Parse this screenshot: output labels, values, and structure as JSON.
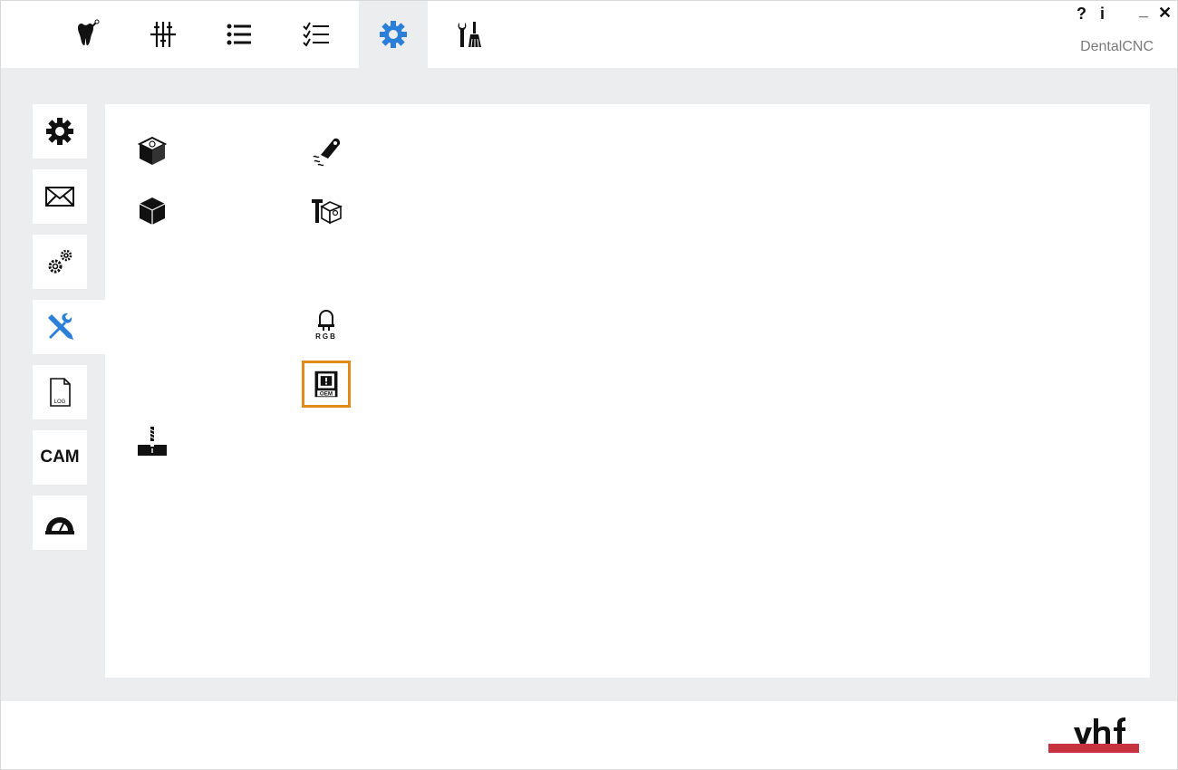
{
  "app": {
    "name": "DentalCNC",
    "help_label": "?",
    "info_label": "i",
    "minimize_label": "_",
    "close_label": "✕"
  },
  "top_tabs": [
    {
      "icon": "tooth-tool-icon"
    },
    {
      "icon": "sliders-icon"
    },
    {
      "icon": "list-icon"
    },
    {
      "icon": "checklist-icon"
    },
    {
      "icon": "gear-icon",
      "active": true
    },
    {
      "icon": "tools-cleaning-icon"
    }
  ],
  "sidebar": {
    "items": [
      {
        "icon": "gear-icon"
      },
      {
        "icon": "envelope-icon"
      },
      {
        "icon": "gears-icon"
      },
      {
        "icon": "wrench-screwdriver-icon",
        "active": true
      },
      {
        "icon": "log-file-icon",
        "label": "LOG"
      },
      {
        "icon": "cam-text-icon",
        "label": "CAM"
      },
      {
        "icon": "protractor-icon"
      }
    ]
  },
  "tools": {
    "items": [
      {
        "icon": "cube-settings-icon"
      },
      {
        "icon": "cube-icon"
      },
      {
        "icon": "spindle-tool-icon"
      },
      {
        "icon": "air-blower-icon"
      },
      {
        "icon": "box-tool-icon"
      },
      {
        "icon": "rgb-led-icon",
        "label": "RGB"
      },
      {
        "icon": "oem-icon",
        "label": "OEM",
        "highlighted": true
      }
    ]
  },
  "brand": {
    "logo": "vhf",
    "accent": "#c6323f",
    "highlight": "#e08a17",
    "active_icon": "#2b7fd9"
  }
}
